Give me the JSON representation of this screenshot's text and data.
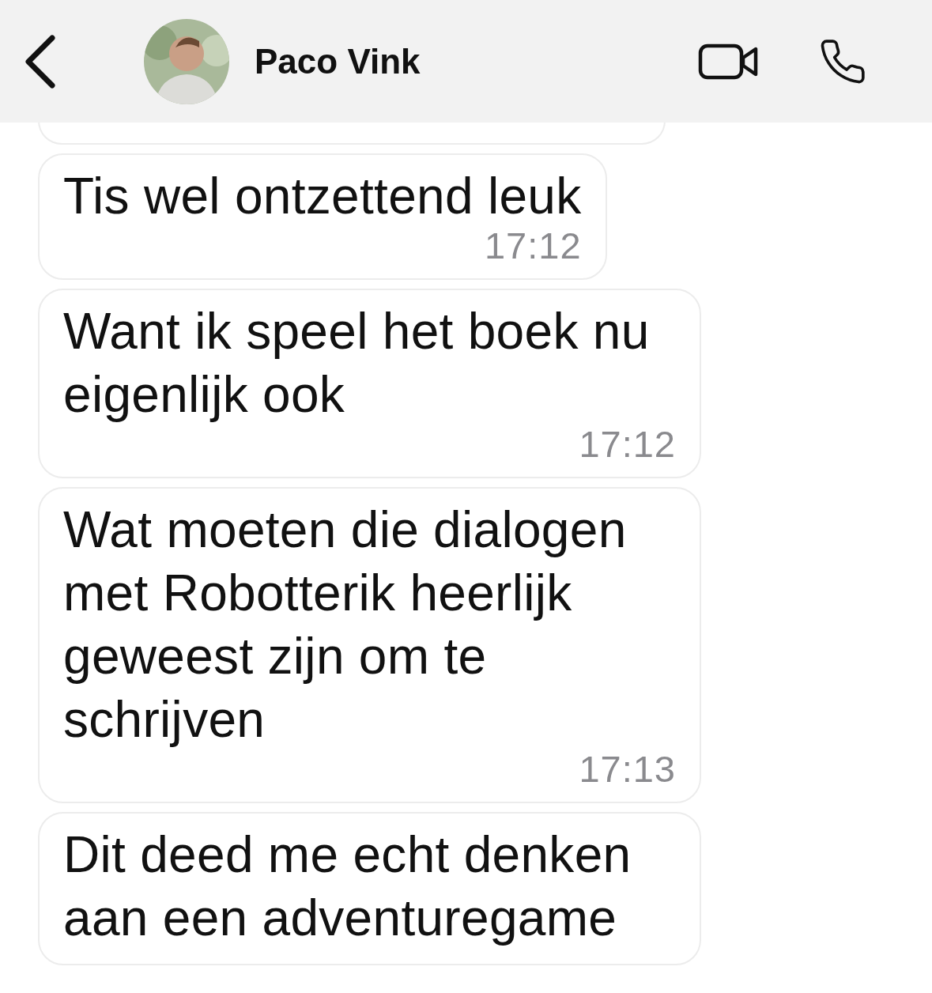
{
  "header": {
    "contact_name": "Paco Vink"
  },
  "messages": [
    {
      "kind": "clipped"
    },
    {
      "kind": "text",
      "text": "Tis wel ontzettend leuk",
      "time": "17:12"
    },
    {
      "kind": "text",
      "text": "Want ik speel het boek nu eigenlijk ook",
      "time": "17:12"
    },
    {
      "kind": "text",
      "text": "Wat moeten die dialogen met Robotterik heerlijk geweest zijn om te schrijven",
      "time": "17:13"
    },
    {
      "kind": "text",
      "text": "Dit deed me echt denken aan een adventuregame"
    }
  ]
}
